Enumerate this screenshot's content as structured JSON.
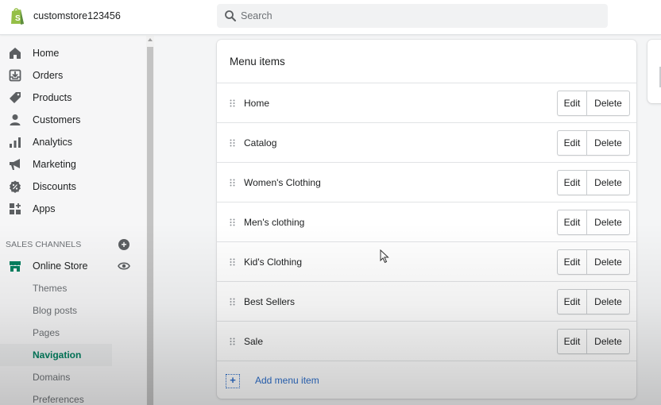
{
  "topbar": {
    "store_name": "customstore123456",
    "search_placeholder": "Search"
  },
  "sidebar": {
    "items": [
      {
        "label": "Home",
        "icon": "home-icon"
      },
      {
        "label": "Orders",
        "icon": "orders-icon"
      },
      {
        "label": "Products",
        "icon": "tag-icon"
      },
      {
        "label": "Customers",
        "icon": "person-icon"
      },
      {
        "label": "Analytics",
        "icon": "bar-chart-icon"
      },
      {
        "label": "Marketing",
        "icon": "megaphone-icon"
      },
      {
        "label": "Discounts",
        "icon": "discount-icon"
      },
      {
        "label": "Apps",
        "icon": "apps-icon"
      }
    ],
    "sales_channels_title": "SALES CHANNELS",
    "channel": {
      "label": "Online Store",
      "icon": "store-icon"
    },
    "sub_items": [
      {
        "label": "Themes",
        "active": false
      },
      {
        "label": "Blog posts",
        "active": false
      },
      {
        "label": "Pages",
        "active": false
      },
      {
        "label": "Navigation",
        "active": true
      },
      {
        "label": "Domains",
        "active": false
      },
      {
        "label": "Preferences",
        "active": false
      }
    ]
  },
  "card": {
    "title": "Menu items",
    "edit_label": "Edit",
    "delete_label": "Delete",
    "rows": [
      {
        "label": "Home"
      },
      {
        "label": "Catalog"
      },
      {
        "label": "Women's Clothing"
      },
      {
        "label": "Men's clothing"
      },
      {
        "label": "Kid's Clothing"
      },
      {
        "label": "Best Sellers"
      },
      {
        "label": "Sale"
      }
    ],
    "add_label": "Add menu item"
  },
  "colors": {
    "accent_green": "#008060",
    "link_blue": "#2c6ecb",
    "logo_green": "#95bf47"
  }
}
